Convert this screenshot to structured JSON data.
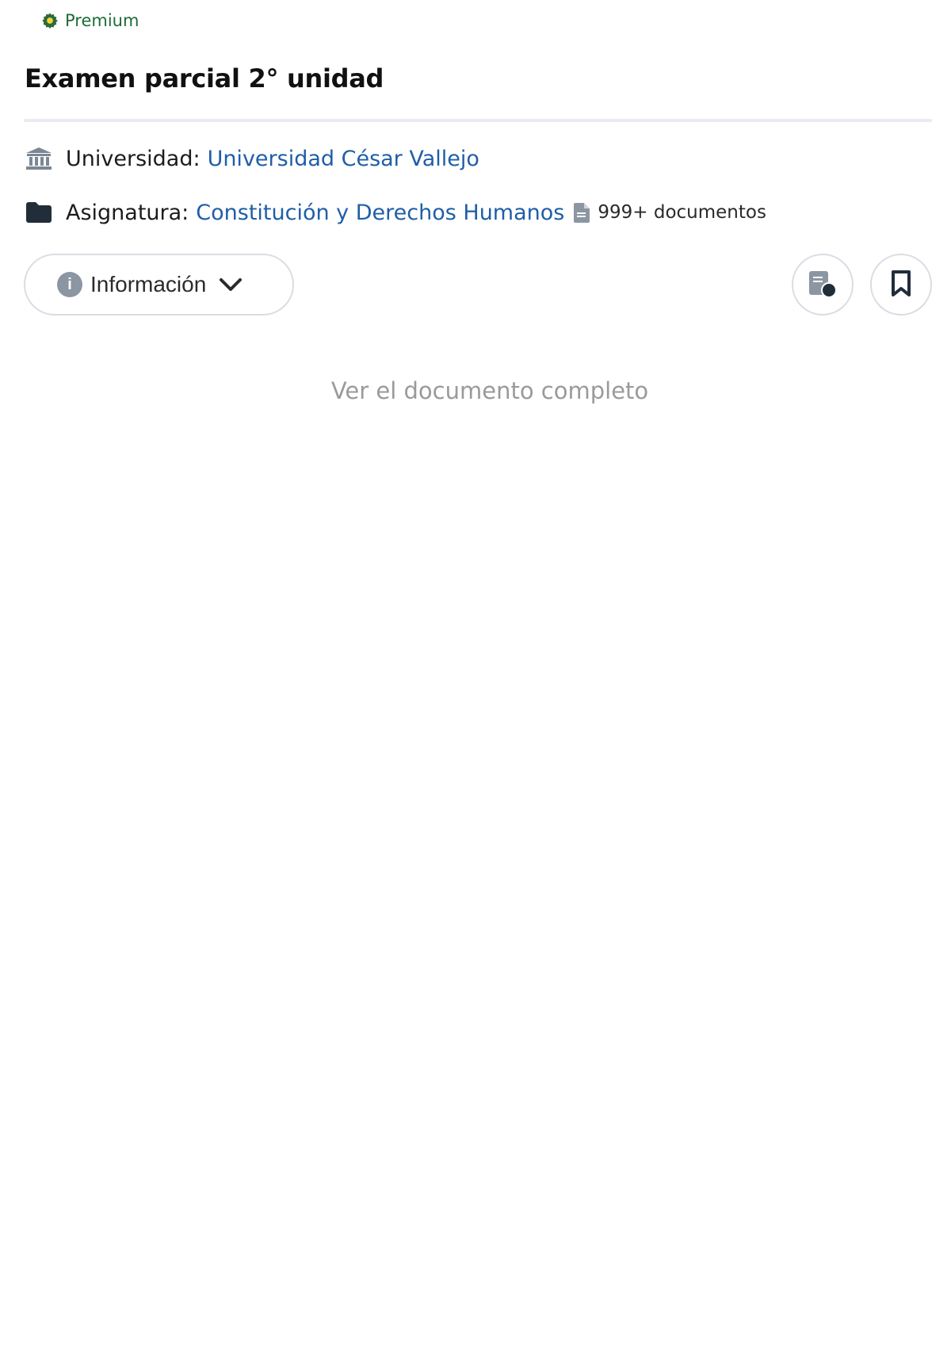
{
  "badge": {
    "label": "Premium",
    "icon": "premium-gear-icon",
    "color": "#1f6b3a"
  },
  "document": {
    "title": "Examen parcial 2° unidad"
  },
  "meta": {
    "university": {
      "label": "Universidad:",
      "value": "Universidad César Vallejo",
      "icon": "university-icon"
    },
    "subject": {
      "label": "Asignatura:",
      "value": "Constitución y Derechos Humanos",
      "icon": "folder-icon"
    },
    "doc_count": {
      "value": "999+ documentos",
      "icon": "document-icon"
    }
  },
  "actions": {
    "info_label": "Información",
    "notes_icon": "notes-icon",
    "bookmark_icon": "bookmark-icon"
  },
  "view_full_label": "Ver el documento completo",
  "colors": {
    "link": "#1f5ea8",
    "muted": "#9a9a9a",
    "border": "#d9dde3",
    "icon": "#222d3a"
  }
}
